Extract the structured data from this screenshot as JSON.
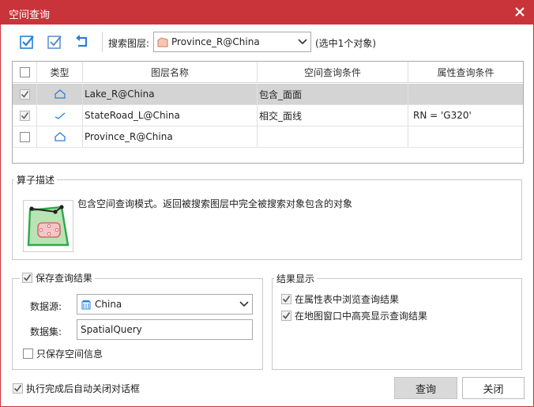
{
  "window": {
    "title": "空间查询"
  },
  "toolbar": {
    "select_all_icon": "check-all-icon",
    "select_none_icon": "check-outline-icon",
    "reverse_icon": "undo-arrow-icon",
    "search_layer_label": "搜索图层:",
    "search_layer_value": "Province_R@China",
    "selection_note": "(选中1个对象)"
  },
  "table": {
    "columns": [
      "类型",
      "图层名称",
      "空间查询条件",
      "属性查询条件"
    ],
    "rows": [
      {
        "checked": true,
        "type_icon": "region-icon",
        "layer": "Lake_R@China",
        "spatial": "包含_面面",
        "attribute": "",
        "selected": true
      },
      {
        "checked": true,
        "type_icon": "line-icon",
        "layer": "StateRoad_L@China",
        "spatial": "相交_面线",
        "attribute": "RN = 'G320'",
        "selected": false
      },
      {
        "checked": false,
        "type_icon": "region-icon",
        "layer": "Province_R@China",
        "spatial": "",
        "attribute": "",
        "selected": false
      }
    ]
  },
  "operator": {
    "title": "算子描述",
    "description": "包含空间查询模式。返回被搜索图层中完全被搜索对象包含的对象"
  },
  "save_result": {
    "title": "保存查询结果",
    "checked": true,
    "datasource_label": "数据源:",
    "datasource_value": "China",
    "dataset_label": "数据集:",
    "dataset_value": "SpatialQuery",
    "spatial_only_label": "只保存空间信息",
    "spatial_only_checked": false
  },
  "display": {
    "title": "结果显示",
    "browse_label": "在属性表中浏览查询结果",
    "browse_checked": true,
    "highlight_label": "在地图窗口中高亮显示查询结果",
    "highlight_checked": true
  },
  "footer": {
    "auto_close_label": "执行完成后自动关闭对话框",
    "auto_close_checked": true,
    "query_button": "查询",
    "close_button": "关闭"
  },
  "colors": {
    "title_bar": "#c9343b",
    "accent_blue": "#2a7fd4",
    "selected_row": "#d4d4d4"
  }
}
